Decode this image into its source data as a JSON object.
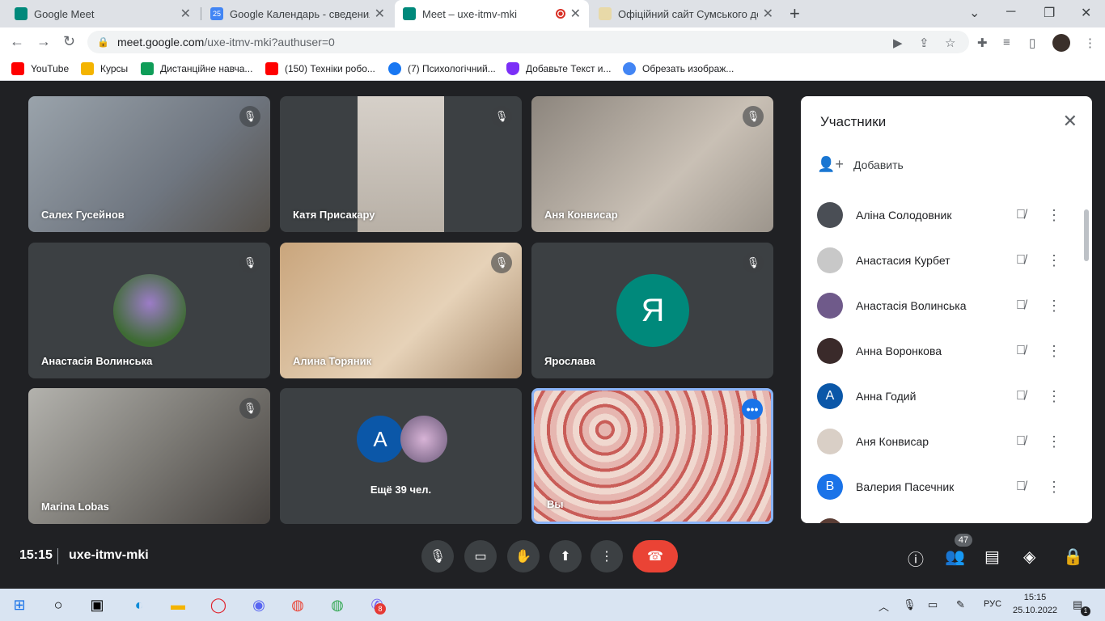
{
  "browser": {
    "tabs": [
      {
        "title": "Google Meet",
        "active": false
      },
      {
        "title": "Google Календарь - сведения о",
        "active": false
      },
      {
        "title": "Meet – uxe-itmv-mki",
        "active": true
      },
      {
        "title": "Офіційний сайт Сумського держ",
        "active": false
      }
    ],
    "new_tab": "+",
    "url_host": "meet.google.com",
    "url_path": "/uxe-itmv-mki?authuser=0",
    "bookmarks": [
      {
        "label": "YouTube",
        "color": "#ff0000"
      },
      {
        "label": "Курсы",
        "color": "#f4b400"
      },
      {
        "label": "Дистанційне навча...",
        "color": "#0f9d58"
      },
      {
        "label": "(150) Техніки робо...",
        "color": "#ff0000"
      },
      {
        "label": "(7) Психологічний...",
        "color": "#1877f2"
      },
      {
        "label": "Добавьте Текст и...",
        "color": "#7b2ff7"
      },
      {
        "label": "Обрезать изображ...",
        "color": "#4285f4"
      }
    ]
  },
  "tiles": [
    {
      "name": "Салех Гусейнов",
      "muted": true,
      "bg": "#7a8088"
    },
    {
      "name": "Катя Присакару",
      "muted": true,
      "bg": "#c8c2bb"
    },
    {
      "name": "Аня Конвисар",
      "muted": true,
      "bg": "#a09a93"
    },
    {
      "name": "Анастасія Волинська",
      "muted": true,
      "bg": "#3c4043"
    },
    {
      "name": "Алина Торяник",
      "muted": true,
      "bg": "#b99a76"
    },
    {
      "name": "Ярослава",
      "muted": true,
      "bg": "#3c4043",
      "initial": "Я"
    },
    {
      "name": "Marina Lobas",
      "muted": true,
      "bg": "#8f8f8a"
    },
    {
      "name": "",
      "muted": false,
      "bg": "#3c4043"
    },
    {
      "name": "Вы",
      "muted": false,
      "bg": "#c9868a"
    }
  ],
  "overflow": {
    "label": "Ещё 39 чел.",
    "initial": "А"
  },
  "panel": {
    "title": "Участники",
    "add_label": "Добавить",
    "participants": [
      {
        "name": "Аліна Солодовник",
        "initial": "",
        "color": "#4a4e55"
      },
      {
        "name": "Анастасия Курбет",
        "initial": "",
        "color": "#c8c8c8"
      },
      {
        "name": "Анастасія Волинська",
        "initial": "",
        "color": "#6f5a8a"
      },
      {
        "name": "Анна Воронкова",
        "initial": "",
        "color": "#3a2a2a"
      },
      {
        "name": "Анна Годий",
        "initial": "А",
        "color": "#0b57a8"
      },
      {
        "name": "Аня Конвисар",
        "initial": "",
        "color": "#d9cfc6"
      },
      {
        "name": "Валерия Пасечник",
        "initial": "В",
        "color": "#1a73e8"
      }
    ]
  },
  "controls": {
    "time": "15:15",
    "meeting_code": "uxe-itmv-mki",
    "participants_count": "47"
  },
  "taskbar": {
    "lang": "РУС",
    "time": "15:15",
    "date": "25.10.2022",
    "viber_badge": "8",
    "notif_badge": "1"
  }
}
